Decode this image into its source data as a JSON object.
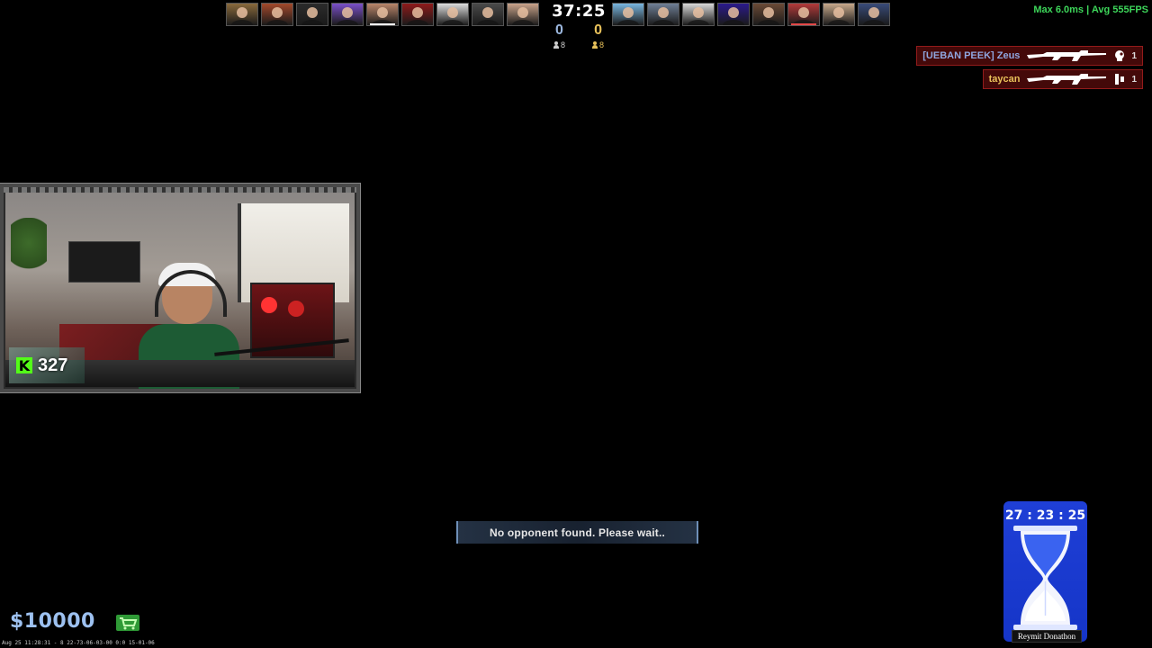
{
  "scoreboard": {
    "round_timer": "37:25",
    "ct_score": "0",
    "t_score": "0",
    "ct_alive": "8",
    "t_alive": "8",
    "left_team_colors": [
      "#8a6a3c",
      "#a3492b",
      "#2b2b2b",
      "#7a4fc8",
      "#b9866a",
      "#8e1a1a",
      "#dcdcdc",
      "#4a4a4a",
      "#c9a38a"
    ],
    "right_team_colors": [
      "#79b6e0",
      "#6f7f96",
      "#d7d7d7",
      "#2b1a8c",
      "#6b4a36",
      "#b33a3a",
      "#c7a88a",
      "#394b7a"
    ],
    "left_highlighted_index": 4,
    "right_highlighted_index": 5
  },
  "netgraph": {
    "text": "Max  6.0ms | Avg  555FPS"
  },
  "killfeed": [
    {
      "killer": "[UEBAN PEEK] Zeus",
      "side": "ct",
      "count": "1"
    },
    {
      "killer": "taycan",
      "side": "t",
      "count": "1"
    }
  ],
  "webcam": {
    "viewer_count": "327",
    "platform_logo": "K"
  },
  "notice": {
    "text": "No opponent found. Please wait.."
  },
  "hud": {
    "money": "$10000",
    "footer": "Aug 25 11:28:31 - 8 22-73-06-03-00 0:0 15-01-06"
  },
  "subathon": {
    "timer": "27 : 23 : 25",
    "label": "Reymit Donathon"
  },
  "colors": {
    "ct": "#9bb7de",
    "t": "#e8c15a",
    "netgraph": "#3dd65a",
    "timer_panel": "#1f3fd6",
    "kick_green": "#53fc18"
  }
}
